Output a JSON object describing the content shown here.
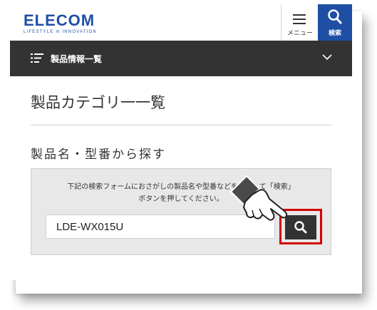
{
  "header": {
    "logo_text": "ELECOM",
    "logo_tagline": "LIFESTYLE m INNOVATION",
    "menu_label": "メニュー",
    "search_label": "検索"
  },
  "nav": {
    "label": "製品情報一覧"
  },
  "page": {
    "title": "製品カテゴリ一一覧",
    "section_title": "製品名・型番から探す"
  },
  "search": {
    "instruction_line1": "下記の検索フォームにおさがしの製品名や型番などを入力して「検索」",
    "instruction_line2": "ボタンを押してください。",
    "query": "LDE-WX015U"
  },
  "colors": {
    "brand_blue": "#1f4fa5",
    "nav_dark": "#333333",
    "highlight_red": "#d40000"
  }
}
